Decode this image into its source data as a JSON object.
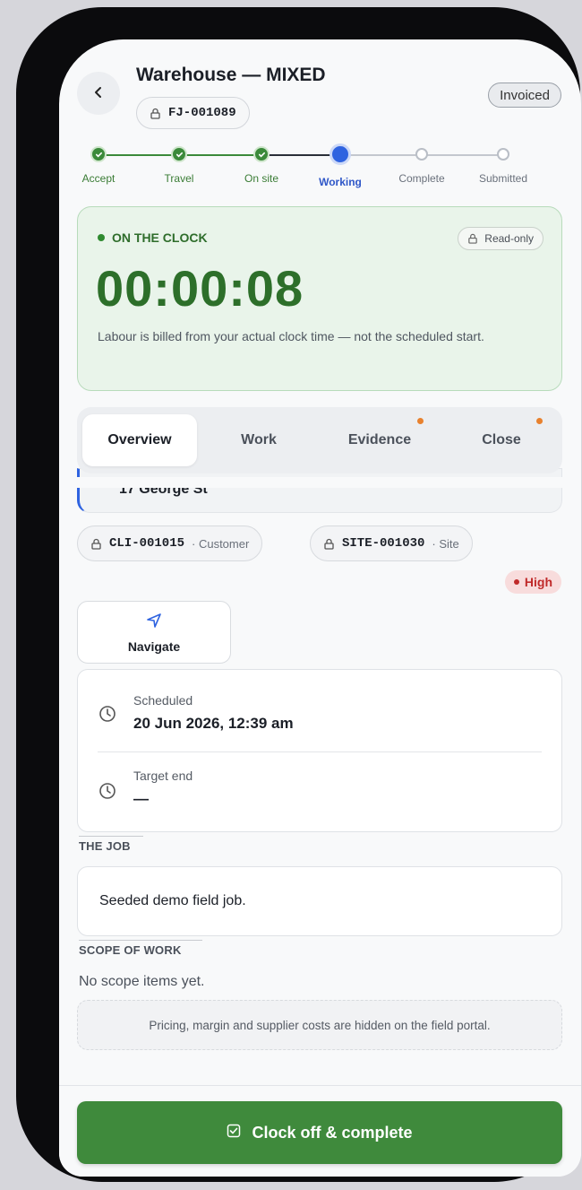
{
  "header": {
    "back_icon": "chevron-left-icon",
    "title": "Warehouse — MIXED",
    "job_ref": "FJ-001089",
    "status_badge": "Invoiced"
  },
  "stepper": {
    "steps": [
      {
        "label": "Accept",
        "state": "done"
      },
      {
        "label": "Travel",
        "state": "done"
      },
      {
        "label": "On site",
        "state": "done"
      },
      {
        "label": "Working",
        "state": "current"
      },
      {
        "label": "Complete",
        "state": "todo"
      },
      {
        "label": "Submitted",
        "state": "todo"
      }
    ]
  },
  "clock": {
    "status": "ON THE CLOCK",
    "readonly_label": "Read-only",
    "timer": "00:00:08",
    "note": "Labour is billed from your actual clock time — not the scheduled start."
  },
  "tabs": [
    {
      "label": "Overview",
      "active": true,
      "has_dot": false
    },
    {
      "label": "Work",
      "active": false,
      "has_dot": false
    },
    {
      "label": "Evidence",
      "active": false,
      "has_dot": true
    },
    {
      "label": "Close",
      "active": false,
      "has_dot": true
    }
  ],
  "overview": {
    "address_partial": "17 George St",
    "customer_ref": "CLI-001015",
    "customer_kind": "· Customer",
    "site_ref": "SITE-001030",
    "site_kind": "· Site",
    "priority": "High",
    "navigate_label": "Navigate",
    "scheduled_label": "Scheduled",
    "scheduled_value": "20 Jun 2026, 12:39 am",
    "target_end_label": "Target end",
    "target_end_value": "—",
    "the_job_heading": "THE JOB",
    "job_description": "Seeded demo field job.",
    "scope_heading": "SCOPE OF WORK",
    "scope_empty": "No scope items yet.",
    "pricing_note": "Pricing, margin and supplier costs are hidden on the field portal."
  },
  "action": {
    "cta_label": "Clock off & complete",
    "cta_icon": "checkbox-icon"
  },
  "colors": {
    "accent_green": "#3f8a3c",
    "current_step_blue": "#2f63e0",
    "priority_red": "#c02a2a",
    "tab_dot_orange": "#e8812e"
  }
}
